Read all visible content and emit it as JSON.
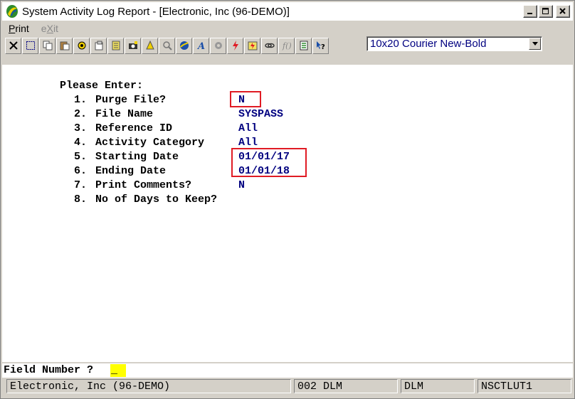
{
  "window": {
    "title": "System Activity Log Report - [Electronic, Inc (96-DEMO)]"
  },
  "menu": {
    "items": [
      {
        "label": "Print",
        "enabled": true
      },
      {
        "label": "eXit",
        "enabled": false
      }
    ]
  },
  "toolbar": {
    "font_select_value": "10x20 Courier New-Bold",
    "icons": [
      "close-icon",
      "select-icon",
      "copy-icon",
      "paste-icon",
      "settings-icon",
      "properties-icon",
      "notepad-icon",
      "camera-icon",
      "bell-icon",
      "search-icon",
      "globe-icon",
      "font-icon",
      "tools-icon",
      "lightning-icon",
      "quick-icon",
      "link-icon",
      "function-icon",
      "list-icon",
      "help-icon"
    ]
  },
  "form": {
    "heading": "Please Enter:",
    "fields": [
      {
        "num": "1.",
        "label": "Purge File?",
        "value": "N"
      },
      {
        "num": "2.",
        "label": "File Name",
        "value": "SYSPASS"
      },
      {
        "num": "3.",
        "label": "Reference ID",
        "value": "All"
      },
      {
        "num": "4.",
        "label": "Activity Category",
        "value": "All"
      },
      {
        "num": "5.",
        "label": "Starting Date",
        "value": "01/01/17"
      },
      {
        "num": "6.",
        "label": "Ending Date",
        "value": "01/01/18"
      },
      {
        "num": "7.",
        "label": "Print Comments?",
        "value": "N"
      },
      {
        "num": "8.",
        "label": "No of Days to Keep?",
        "value": ""
      }
    ]
  },
  "prompt": {
    "label": "Field Number ?",
    "cursor": "_"
  },
  "status": {
    "company": "Electronic, Inc (96-DEMO)",
    "code": "002 DLM",
    "user": "DLM",
    "program": "NSCTLUT1"
  },
  "colors": {
    "highlight": "#e01b24",
    "value_text": "#000080",
    "cursor_bg": "#ffff00"
  }
}
